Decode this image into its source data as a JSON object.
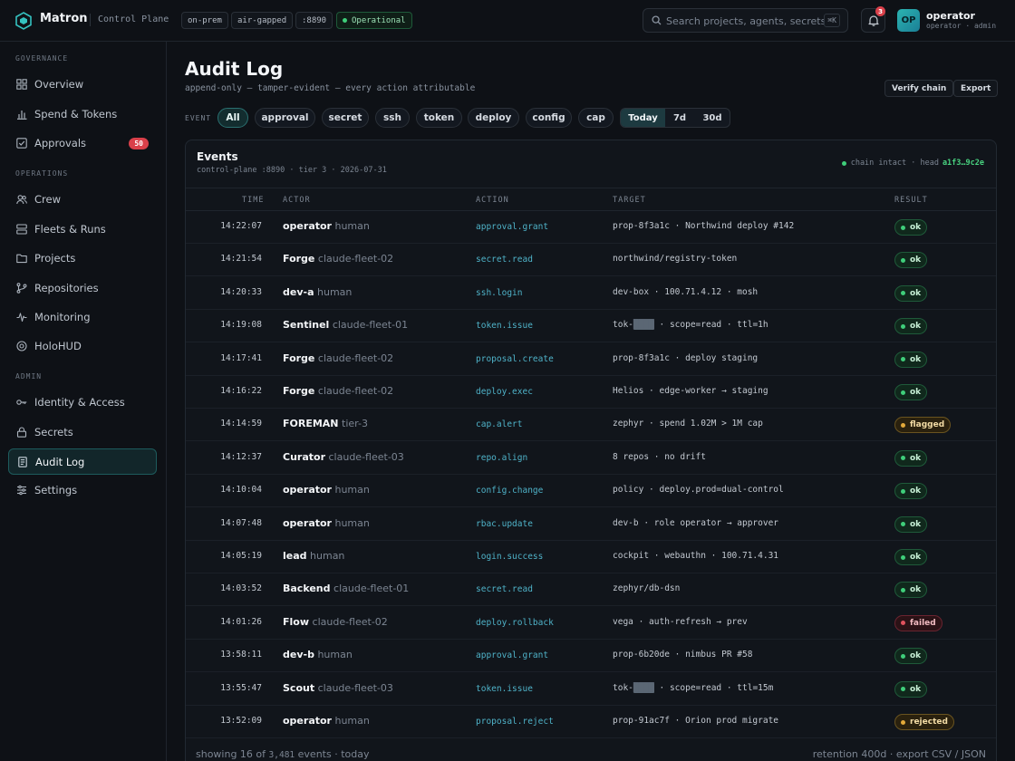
{
  "app": {
    "name": "Matron",
    "subtitle": "Control Plane",
    "chips": [
      "on-prem",
      "air-gapped",
      ":8890"
    ],
    "status": "Operational",
    "search_placeholder": "Search projects, agents, secrets...",
    "search_shortcut": "⌘K",
    "notifications": "3",
    "user": {
      "initials": "OP",
      "name": "operator",
      "role": "operator · admin"
    }
  },
  "sidebar": {
    "sections": [
      {
        "label": "GOVERNANCE",
        "items": [
          {
            "label": "Overview",
            "icon": "grid-icon"
          },
          {
            "label": "Spend & Tokens",
            "icon": "bar-chart-icon"
          },
          {
            "label": "Approvals",
            "icon": "check-square-icon",
            "badge": "50"
          }
        ]
      },
      {
        "label": "OPERATIONS",
        "items": [
          {
            "label": "Crew",
            "icon": "users-icon"
          },
          {
            "label": "Fleets & Runs",
            "icon": "server-icon"
          },
          {
            "label": "Projects",
            "icon": "folder-icon"
          },
          {
            "label": "Repositories",
            "icon": "git-branch-icon"
          },
          {
            "label": "Monitoring",
            "icon": "pulse-icon"
          },
          {
            "label": "HoloHUD",
            "icon": "target-icon"
          }
        ]
      },
      {
        "label": "ADMIN",
        "items": [
          {
            "label": "Identity & Access",
            "icon": "key-icon"
          },
          {
            "label": "Secrets",
            "icon": "lock-icon"
          },
          {
            "label": "Audit Log",
            "icon": "document-icon",
            "active": true
          },
          {
            "label": "Settings",
            "icon": "sliders-icon"
          }
        ]
      }
    ]
  },
  "page": {
    "title": "Audit Log",
    "subtitle": "append-only — tamper-evident — every action attributable",
    "buttons": {
      "verify": "Verify chain",
      "export": "Export"
    },
    "filter_label": "EVENT",
    "filters": [
      "All",
      "approval",
      "secret",
      "ssh",
      "token",
      "deploy",
      "config",
      "cap"
    ],
    "active_filter": "All",
    "ranges": [
      "Today",
      "7d",
      "30d"
    ],
    "active_range": "Today"
  },
  "panel": {
    "title": "Events",
    "subtitle": "control-plane :8890 · tier 3 · 2026-07-31",
    "chain_status": "chain intact · head",
    "chain_head": "a1f3…9c2e",
    "columns": [
      "TIME",
      "ACTOR",
      "ACTION",
      "TARGET",
      "RESULT"
    ],
    "rows": [
      {
        "time": "14:22:07",
        "actor": "operator",
        "actor_kind": "human",
        "action": "approval.grant",
        "target": "prop-8f3a1c · Northwind deploy #142",
        "result": "ok"
      },
      {
        "time": "14:21:54",
        "actor": "Forge",
        "actor_kind": "claude-fleet-02",
        "action": "secret.read",
        "target": "northwind/registry-token",
        "result": "ok"
      },
      {
        "time": "14:20:33",
        "actor": "dev-a",
        "actor_kind": "human",
        "action": "ssh.login",
        "target": "dev-box · 100.71.4.12 · mosh",
        "result": "ok"
      },
      {
        "time": "14:19:08",
        "actor": "Sentinel",
        "actor_kind": "claude-fleet-01",
        "action": "token.issue",
        "target_pre": "tok-",
        "target_redact": "████",
        "target_post": " · scope=read · ttl=1h",
        "result": "ok"
      },
      {
        "time": "14:17:41",
        "actor": "Forge",
        "actor_kind": "claude-fleet-02",
        "action": "proposal.create",
        "target": "prop-8f3a1c · deploy staging",
        "result": "ok"
      },
      {
        "time": "14:16:22",
        "actor": "Forge",
        "actor_kind": "claude-fleet-02",
        "action": "deploy.exec",
        "target": "Helios · edge-worker → staging",
        "result": "ok"
      },
      {
        "time": "14:14:59",
        "actor": "FOREMAN",
        "actor_kind": "tier-3",
        "action": "cap.alert",
        "target": "zephyr · spend 1.02M > 1M cap",
        "result": "flagged"
      },
      {
        "time": "14:12:37",
        "actor": "Curator",
        "actor_kind": "claude-fleet-03",
        "action": "repo.align",
        "target": "8 repos · no drift",
        "result": "ok"
      },
      {
        "time": "14:10:04",
        "actor": "operator",
        "actor_kind": "human",
        "action": "config.change",
        "target": "policy · deploy.prod=dual-control",
        "result": "ok"
      },
      {
        "time": "14:07:48",
        "actor": "operator",
        "actor_kind": "human",
        "action": "rbac.update",
        "target": "dev-b · role operator → approver",
        "result": "ok"
      },
      {
        "time": "14:05:19",
        "actor": "lead",
        "actor_kind": "human",
        "action": "login.success",
        "target": "cockpit · webauthn · 100.71.4.31",
        "result": "ok"
      },
      {
        "time": "14:03:52",
        "actor": "Backend",
        "actor_kind": "claude-fleet-01",
        "action": "secret.read",
        "target": "zephyr/db-dsn",
        "result": "ok"
      },
      {
        "time": "14:01:26",
        "actor": "Flow",
        "actor_kind": "claude-fleet-02",
        "action": "deploy.rollback",
        "target": "vega · auth-refresh → prev",
        "result": "failed"
      },
      {
        "time": "13:58:11",
        "actor": "dev-b",
        "actor_kind": "human",
        "action": "approval.grant",
        "target": "prop-6b20de · nimbus PR #58",
        "result": "ok"
      },
      {
        "time": "13:55:47",
        "actor": "Scout",
        "actor_kind": "claude-fleet-03",
        "action": "token.issue",
        "target_pre": "tok-",
        "target_redact": "████",
        "target_post": " · scope=read · ttl=15m",
        "result": "ok"
      },
      {
        "time": "13:52:09",
        "actor": "operator",
        "actor_kind": "human",
        "action": "proposal.reject",
        "target": "prop-91ac7f · Orion prod migrate",
        "result": "rejected"
      }
    ]
  },
  "footer": {
    "showing_pre": "showing 16 of",
    "total": "3,481",
    "showing_post": "events · today",
    "right": "retention 400d · export CSV / JSON"
  }
}
